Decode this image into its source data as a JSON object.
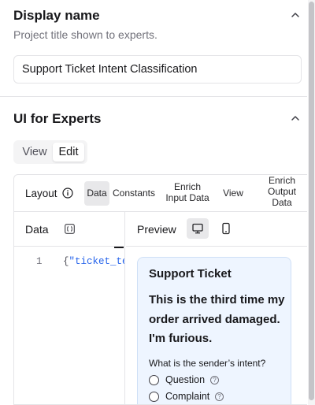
{
  "display_name": {
    "title": "Display name",
    "subtitle": "Project title shown to experts.",
    "value": "Support Ticket Intent Classification"
  },
  "ui_for_experts": {
    "title": "UI for Experts",
    "mode_toggle": {
      "view_label": "View",
      "edit_label": "Edit",
      "selected": "Edit"
    },
    "layout_label": "Layout",
    "tabs": [
      {
        "label": "Data",
        "selected": true
      },
      {
        "label": "Constants"
      },
      {
        "label": "Enrich Input Data"
      },
      {
        "label": "View"
      },
      {
        "label": "Enrich Output Data"
      }
    ],
    "data_pane": {
      "label": "Data",
      "line_number": "1",
      "code_brace": "{",
      "code_text": "\"ticket_te"
    },
    "preview_pane": {
      "label": "Preview",
      "card": {
        "title": "Support Ticket",
        "message": "This is the third time my order arrived damaged. I'm furious.",
        "question": "What is the sender’s intent?",
        "options": [
          {
            "label": "Question"
          },
          {
            "label": "Complaint"
          }
        ],
        "help_glyph": "?"
      }
    }
  },
  "icons": {
    "collapse": "chevron-up-icon",
    "info": "info-icon",
    "braces": "code-braces-icon",
    "desktop": "monitor-icon",
    "mobile": "smartphone-icon",
    "help": "help-circle-icon"
  },
  "colors": {
    "card_bg": "#eef5ff",
    "card_border": "#cfe0f6",
    "code_text": "#2563eb",
    "selected_tab_bg": "#e8e8ea"
  }
}
